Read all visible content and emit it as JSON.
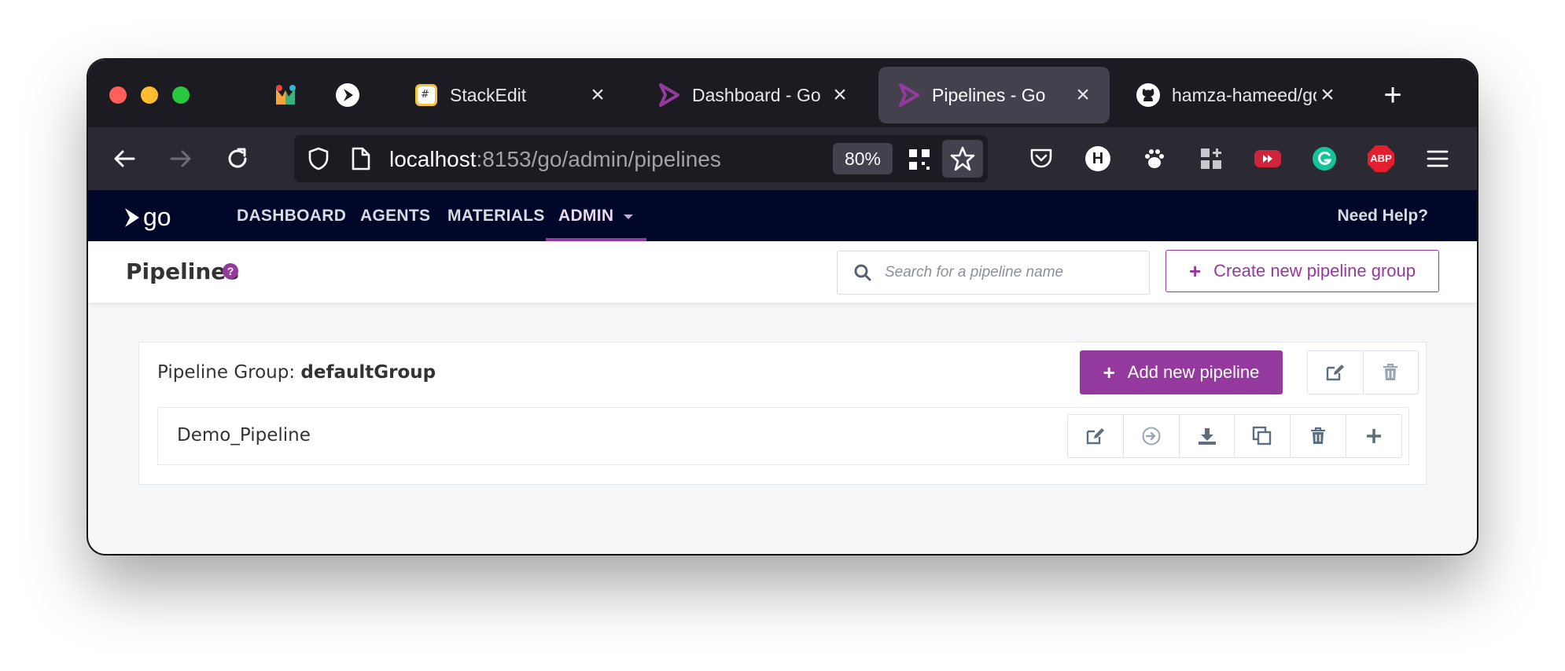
{
  "browser": {
    "pinned_tabs": [
      {
        "icon": "multicolor-app-icon"
      },
      {
        "icon": "gocd-play-icon"
      }
    ],
    "tabs": [
      {
        "label": "StackEdit",
        "icon": "stackedit-icon",
        "active": false
      },
      {
        "label": "Dashboard - Go",
        "icon": "gocd-tab-icon",
        "active": false
      },
      {
        "label": "Pipelines - Go",
        "icon": "gocd-tab-icon",
        "active": true
      },
      {
        "label": "hamza-hameed/go",
        "icon": "github-icon",
        "active": false
      }
    ],
    "url_host": "localhost",
    "url_path": ":8153/go/admin/pipelines",
    "zoom": "80%",
    "extensions": [
      "pocket-icon",
      "h-icon",
      "paw-icon",
      "apps-icon",
      "youtube-icon",
      "grammarly-icon",
      "adblock-icon",
      "menu-icon"
    ],
    "adblock_label": "ABP",
    "h_label": "H"
  },
  "gocd": {
    "logo_text": "go",
    "nav": [
      "DASHBOARD",
      "AGENTS",
      "MATERIALS",
      "ADMIN"
    ],
    "need_help": "Need Help?"
  },
  "page": {
    "title": "Pipelines",
    "help_glyph": "?",
    "search_placeholder": "Search for a pipeline name",
    "create_group_label": "Create new pipeline group"
  },
  "group": {
    "prefix": "Pipeline Group:",
    "name": "defaultGroup",
    "add_pipeline_label": "Add new pipeline",
    "pipelines": [
      {
        "name": "Demo_Pipeline"
      }
    ]
  },
  "colors": {
    "accent": "#943a9e",
    "header_bg": "#000728",
    "browser_chrome": "#1c1b22"
  }
}
